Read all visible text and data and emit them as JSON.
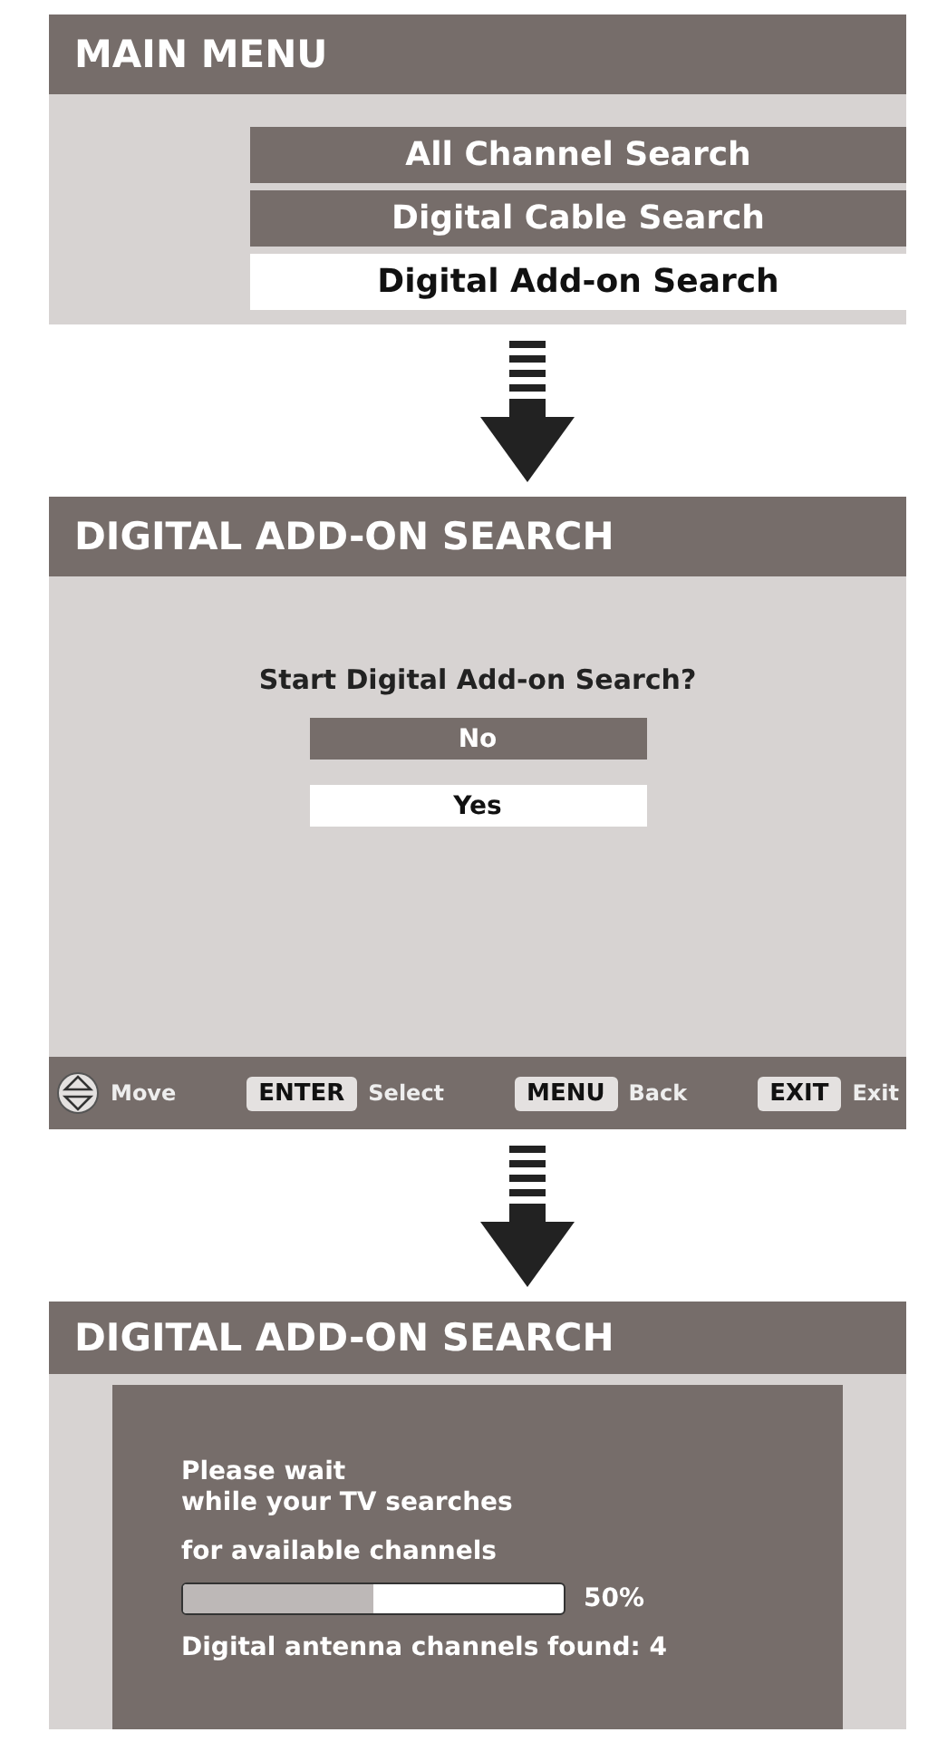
{
  "screens": [
    {
      "kind": "menu",
      "title": "MAIN MENU",
      "items": [
        {
          "label": "All Channel Search",
          "selected": false
        },
        {
          "label": "Digital Cable Search",
          "selected": false
        },
        {
          "label": "Digital Add-on Search",
          "selected": true
        }
      ]
    },
    {
      "kind": "dialog",
      "title": "DIGITAL ADD-ON SEARCH",
      "question": "Start Digital Add-on Search?",
      "options": [
        {
          "label": "No",
          "selected": false
        },
        {
          "label": "Yes",
          "selected": true
        }
      ],
      "footer": [
        {
          "kind": "icon",
          "label": "Move"
        },
        {
          "kind": "key",
          "key": "ENTER",
          "label": "Select"
        },
        {
          "kind": "key",
          "key": "MENU",
          "label": "Back"
        },
        {
          "kind": "key",
          "key": "EXIT",
          "label": "Exit"
        }
      ]
    },
    {
      "kind": "progress",
      "title": "DIGITAL ADD-ON SEARCH",
      "message_lines": [
        "Please wait",
        "while your TV searches"
      ],
      "detail": "for available channels",
      "level": 0.5,
      "reading": "50%",
      "found": "Digital antenna channels found: 4"
    }
  ]
}
